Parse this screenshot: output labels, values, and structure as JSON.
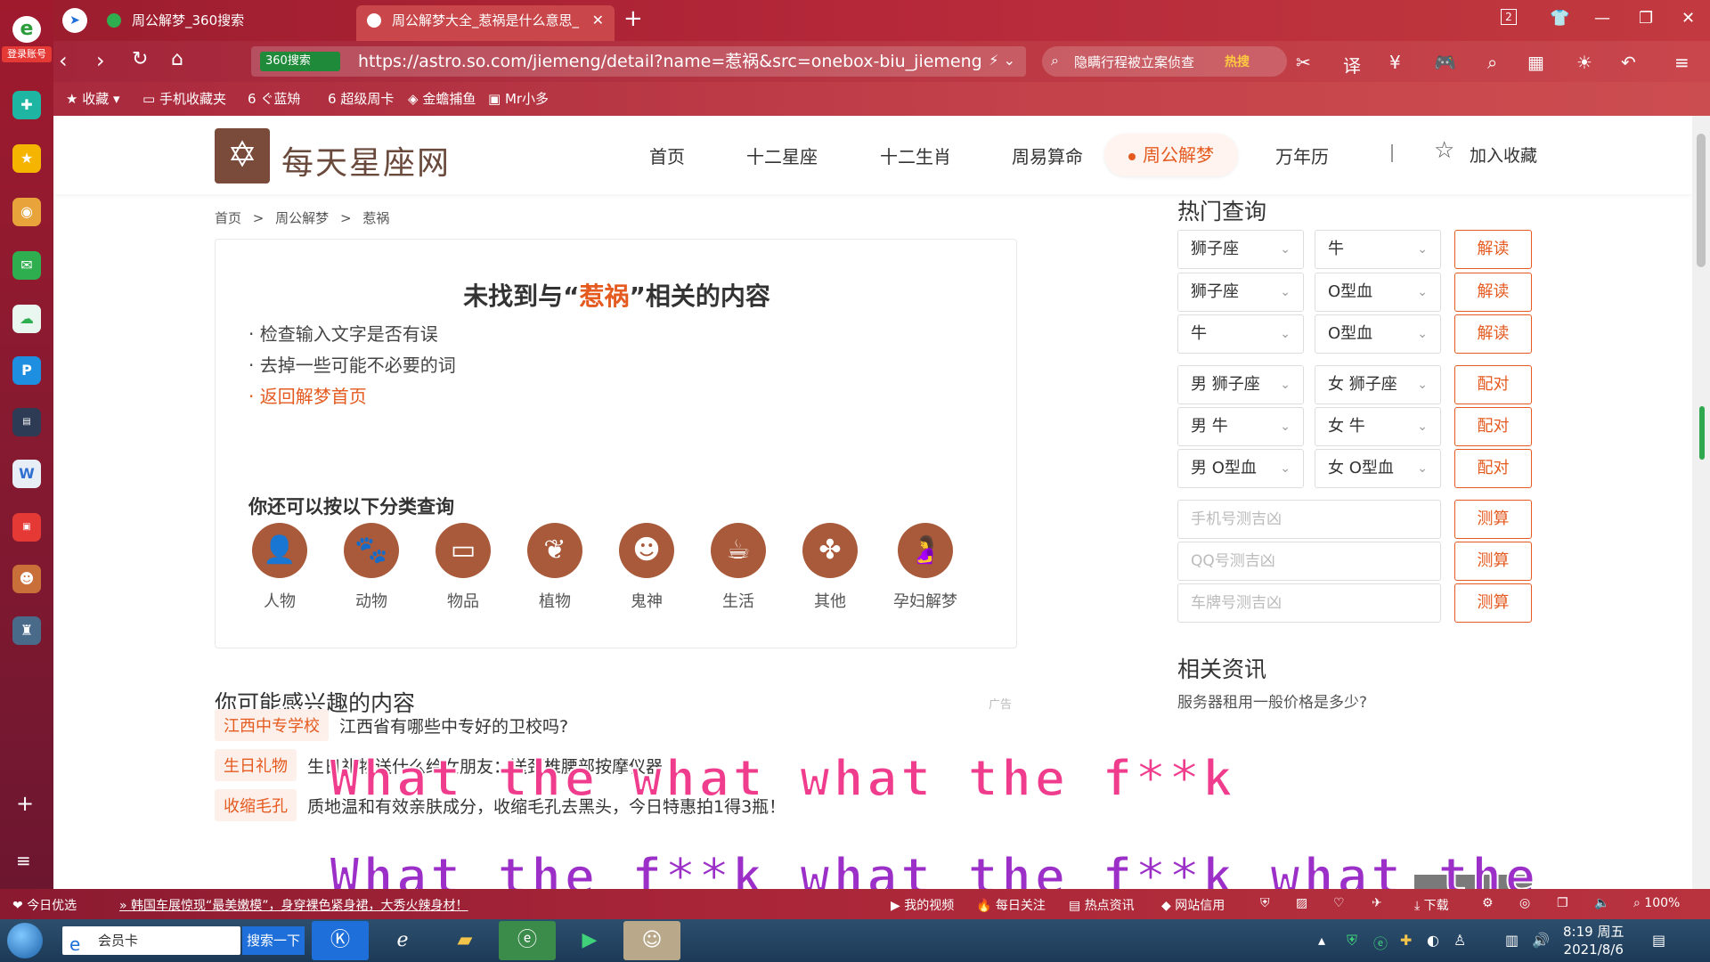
{
  "browser": {
    "login_label": "登录账号",
    "tabs": [
      {
        "title": "周公解梦_360搜索"
      },
      {
        "title": "周公解梦大全_惹祸是什么意思_"
      }
    ],
    "url_badge": "360搜索",
    "url": "https://astro.so.com/jiemeng/detail?name=惹祸&src=onebox-biu_jiemeng",
    "search_text": "隐瞒行程被立案侦查",
    "search_hot": "热搜",
    "tab_count": "2",
    "bookmarks": [
      "收藏",
      "手机收藏夹",
      "ぐ蓝矪",
      "超级周卡",
      "金蟾捕鱼",
      "Mr小多"
    ]
  },
  "site": {
    "logo_text": "每天星座网",
    "nav": [
      "首页",
      "十二星座",
      "十二生肖",
      "周易算命",
      "周公解梦",
      "万年历"
    ],
    "nav_active": "周公解梦",
    "nav_sep": "|",
    "fav_label": "加入收藏"
  },
  "breadcrumb": [
    "首页",
    ">",
    "周公解梦",
    ">",
    "惹祸"
  ],
  "not_found": {
    "title_pre": "未找到与“",
    "keyword": "惹祸",
    "title_post": "”相关的内容",
    "tips": [
      "· 检查输入文字是否有误",
      "· 去掉一些可能不必要的词"
    ],
    "back_link": "· 返回解梦首页",
    "sub_title": "你还可以按以下分类查询",
    "categories": [
      "人物",
      "动物",
      "物品",
      "植物",
      "鬼神",
      "生活",
      "其他",
      "孕妇解梦"
    ]
  },
  "interest": {
    "title": "你可能感兴趣的内容",
    "ad": "广告",
    "items": [
      {
        "tag": "江西中专学校",
        "text": "江西省有哪些中专好的卫校吗?"
      },
      {
        "tag": "生日礼物",
        "text": "生日礼物送什么给女朋友：送颈椎腰部按摩仪器"
      },
      {
        "tag": "收缩毛孔",
        "text": "质地温和有效亲肤成分，收缩毛孔去黑头，今日特惠拍1得3瓶！"
      }
    ]
  },
  "sidebar": {
    "hot_title": "热门查询",
    "rows": [
      {
        "a": "狮子座",
        "b": "牛",
        "btn": "解读"
      },
      {
        "a": "狮子座",
        "b": "O型血",
        "btn": "解读"
      },
      {
        "a": "牛",
        "b": "O型血",
        "btn": "解读"
      },
      {
        "a": "男 狮子座",
        "b": "女 狮子座",
        "btn": "配对"
      },
      {
        "a": "男 牛",
        "b": "女 牛",
        "btn": "配对"
      },
      {
        "a": "男 O型血",
        "b": "女 O型血",
        "btn": "配对"
      }
    ],
    "inputs": [
      {
        "placeholder": "手机号测吉凶",
        "btn": "测算"
      },
      {
        "placeholder": "QQ号测吉凶",
        "btn": "测算"
      },
      {
        "placeholder": "车牌号测吉凶",
        "btn": "测算"
      }
    ],
    "news_title": "相关资讯",
    "news_q": "服务器租用一般价格是多少?"
  },
  "overlay": {
    "line1": "What the what what the f**k",
    "line2": "What the f**k what the f**k what the"
  },
  "statusbar": {
    "left": "今日优选",
    "ticker": "韩国车展惊现“最美嫩模”，身穿裸色紧身裙，大秀火辣身材！",
    "items": [
      "我的视频",
      "每日关注",
      "热点资讯",
      "网站信用"
    ],
    "download": "下载",
    "zoom": "100%"
  },
  "taskbar": {
    "search_value": "会员卡",
    "search_btn": "搜索一下",
    "time": "8:19 周五",
    "date": "2021/8/6"
  },
  "colors": {
    "accent": "#e45a1f",
    "brand": "#7a4a3a"
  }
}
